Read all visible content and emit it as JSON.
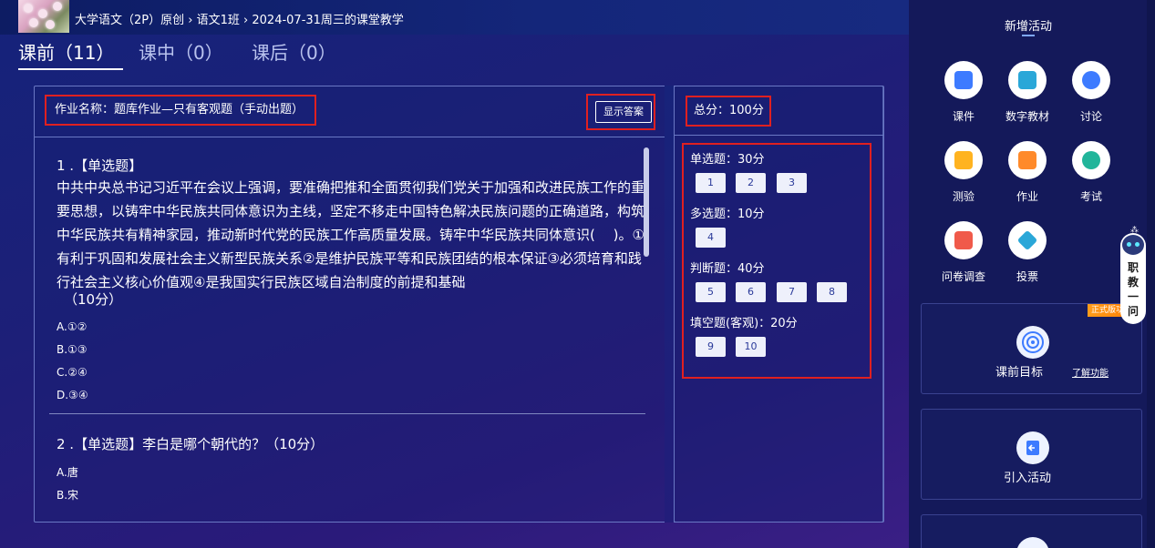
{
  "breadcrumb": {
    "course": "大学语文（2P）原创",
    "sep1": "›",
    "class": "语文1班",
    "sep2": "›",
    "session": "2024-07-31周三的课堂教学"
  },
  "tabs": [
    {
      "label": "课前（11）",
      "active": true
    },
    {
      "label": "课中（0）",
      "active": false
    },
    {
      "label": "课后（0）",
      "active": false
    }
  ],
  "homework": {
    "name_label": "作业名称：题库作业—只有客观题（手动出题）",
    "show_answer_button": "显示答案"
  },
  "questions": [
    {
      "title": "1 .【单选题】",
      "body": "中共中央总书记习近平在会议上强调，要准确把推和全面贯彻我们党关于加强和改进民族工作的重要思想，以铸牢中华民族共同体意识为主线，坚定不移走中国特色解决民族问题的正确道路，构筑中华民族共有精神家园，推动新时代党的民族工作高质量发展。铸牢中华民族共同体意识(　 )。①有利于巩固和发展社会主义新型民族关系②是维护民族平等和民族团结的根本保证③必须培育和践行社会主义核心价值观④是我国实行民族区域自治制度的前提和基础",
      "score": "（10分）",
      "options": [
        "A.①②",
        "B.①③",
        "C.②④",
        "D.③④"
      ]
    },
    {
      "title": "2 .【单选题】李白是哪个朝代的？（10分）",
      "options": [
        "A.唐",
        "B.宋"
      ]
    }
  ],
  "score_panel": {
    "total": "总分：100分",
    "sections": [
      {
        "label": "单选题：30分",
        "numbers": [
          "1",
          "2",
          "3"
        ]
      },
      {
        "label": "多选题：10分",
        "numbers": [
          "4"
        ]
      },
      {
        "label": "判断题：40分",
        "numbers": [
          "5",
          "6",
          "7",
          "8"
        ]
      },
      {
        "label": "填空题(客观)：20分",
        "numbers": [
          "9",
          "10"
        ]
      }
    ]
  },
  "sidebar": {
    "title": "新增活动",
    "activities": [
      {
        "label": "课件",
        "icon": "courseware-icon",
        "color": "#3d7bff"
      },
      {
        "label": "数字教材",
        "icon": "digital-textbook-icon",
        "color": "#2aa7d8"
      },
      {
        "label": "讨论",
        "icon": "discussion-icon",
        "color": "#3d7bff"
      },
      {
        "label": "测验",
        "icon": "quiz-icon",
        "color": "#ffb320"
      },
      {
        "label": "作业",
        "icon": "homework-icon",
        "color": "#ff8a2a"
      },
      {
        "label": "考试",
        "icon": "exam-icon",
        "color": "#21b59a"
      },
      {
        "label": "问卷调查",
        "icon": "survey-icon",
        "color": "#f05a4a"
      },
      {
        "label": "投票",
        "icon": "vote-icon",
        "color": "#2aa7d8"
      }
    ],
    "cards": [
      {
        "label": "课前目标",
        "link": "了解功能",
        "ribbon": "正式版功能"
      },
      {
        "label": "引入活动"
      }
    ],
    "assistant": "职教一问"
  }
}
